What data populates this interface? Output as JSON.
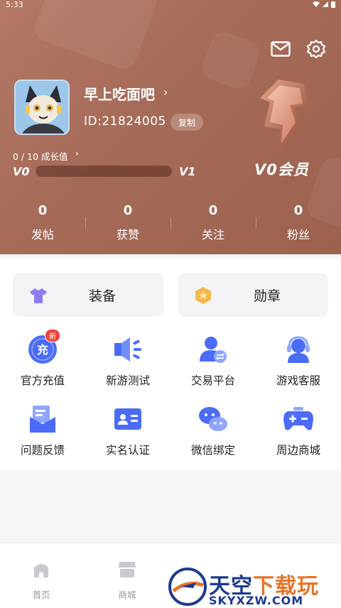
{
  "status_bar": {
    "time": "5:33"
  },
  "profile": {
    "nickname": "早上吃面吧",
    "nickname_chevron": "›",
    "uid": "ID:21824005",
    "copy_label": "复制",
    "growth": "0 / 10 成长值",
    "growth_chevron": "›",
    "level_current": "V0",
    "level_next": "V1",
    "growth_progress": 0,
    "vip_label": "V0会员"
  },
  "stats": [
    {
      "value": "0",
      "label": "发帖"
    },
    {
      "value": "0",
      "label": "获赞"
    },
    {
      "value": "0",
      "label": "关注"
    },
    {
      "value": "0",
      "label": "粉丝"
    }
  ],
  "cards": [
    {
      "label": "装备",
      "icon": "tshirt-icon"
    },
    {
      "label": "勋章",
      "icon": "medal-icon"
    }
  ],
  "services": [
    {
      "label": "官方充值",
      "icon": "recharge-icon",
      "badge": "新",
      "icon_text": "充"
    },
    {
      "label": "新游测试",
      "icon": "speaker-icon"
    },
    {
      "label": "交易平台",
      "icon": "trade-user-icon"
    },
    {
      "label": "游戏客服",
      "icon": "headset-icon"
    },
    {
      "label": "问题反馈",
      "icon": "feedback-icon"
    },
    {
      "label": "实名认证",
      "icon": "id-card-icon"
    },
    {
      "label": "微信绑定",
      "icon": "wechat-icon"
    },
    {
      "label": "周边商城",
      "icon": "gamepad-icon"
    }
  ],
  "tabbar": [
    {
      "label": "首页",
      "icon": "home-icon"
    },
    {
      "label": "商城",
      "icon": "store-icon"
    }
  ],
  "watermark": {
    "text_blue": "天空",
    "text_orange": "下载玩",
    "url": "SKYXZW.COM"
  },
  "colors": {
    "header": "#a56a58",
    "accent_blue": "#4a6cf7",
    "badge_red": "#e8453c"
  }
}
